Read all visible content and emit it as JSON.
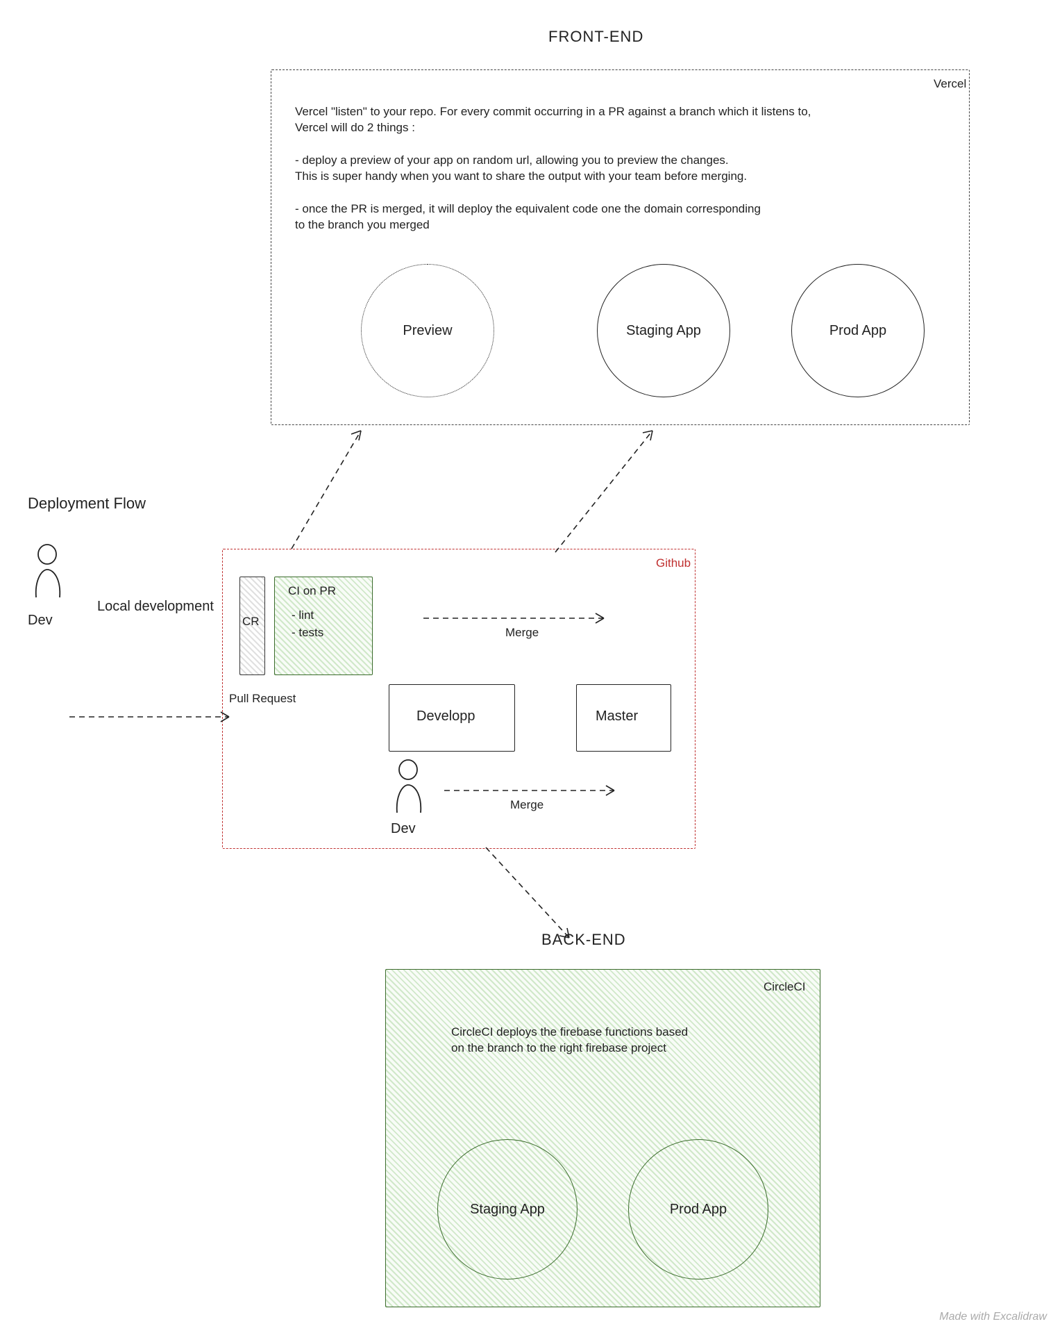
{
  "title_top": "FRONT-END",
  "title_bottom": "BACK-END",
  "flow_title": "Deployment Flow",
  "dev_label": "Dev",
  "local_dev": "Local development",
  "watermark": "Made with Excalidraw",
  "vercel": {
    "box_label": "Vercel",
    "para1": "Vercel \"listen\" to your repo. For every commit occurring in a PR against a branch which it listens to,\nVercel will do 2 things :",
    "bullet1": "- deploy a preview of your app on random url, allowing you to preview the changes.\nThis is super handy when you want to share the output with your team before merging.",
    "bullet2": "- once the PR is merged, it will deploy the equivalent code one the domain corresponding\nto the branch you merged",
    "preview": "Preview",
    "staging": "Staging App",
    "prod": "Prod App"
  },
  "github": {
    "box_label": "Github",
    "cr": "CR",
    "ci_title": "CI on PR",
    "ci_item1": "- lint",
    "ci_item2": "- tests",
    "develop": "Developp",
    "master": "Master",
    "pull_request": "Pull Request",
    "merge": "Merge",
    "dev_under": "Dev"
  },
  "circleci": {
    "box_label": "CircleCI",
    "desc": "CircleCI deploys the firebase functions based\non the branch to the right firebase project",
    "staging": "Staging App",
    "prod": "Prod App"
  }
}
